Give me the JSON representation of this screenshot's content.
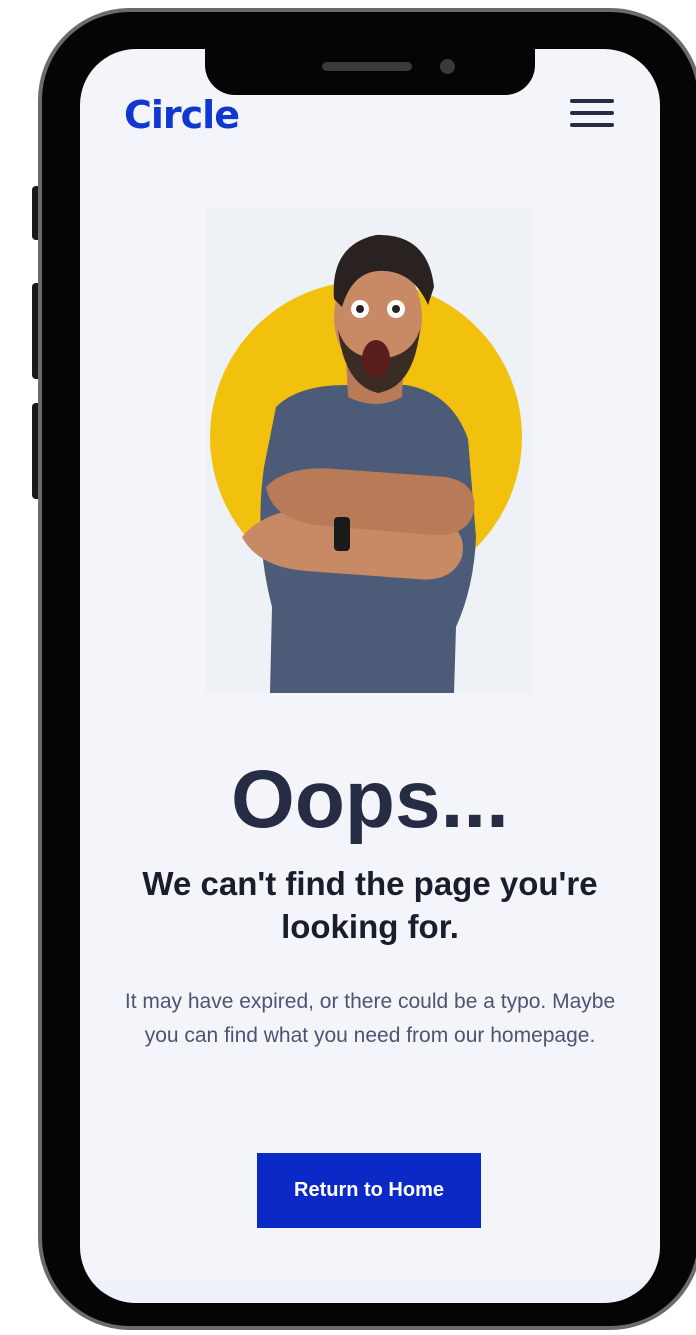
{
  "header": {
    "logo": "Circle",
    "menu_icon": "hamburger-menu-icon"
  },
  "hero_image": {
    "subject": "surprised-man-arms-crossed",
    "circle_color": "#f2c10e",
    "shirt_color": "#4b5b78"
  },
  "content": {
    "title": "Oops...",
    "subtitle": "We can't find the page you're looking for.",
    "body": "It may have expired, or there could be a typo. Maybe you can find what you need from our homepage.",
    "button_label": "Return to Home"
  },
  "colors": {
    "brand": "#1038d0",
    "button": "#0a29c7",
    "heading": "#252c44",
    "background": "#f4f5fa"
  }
}
